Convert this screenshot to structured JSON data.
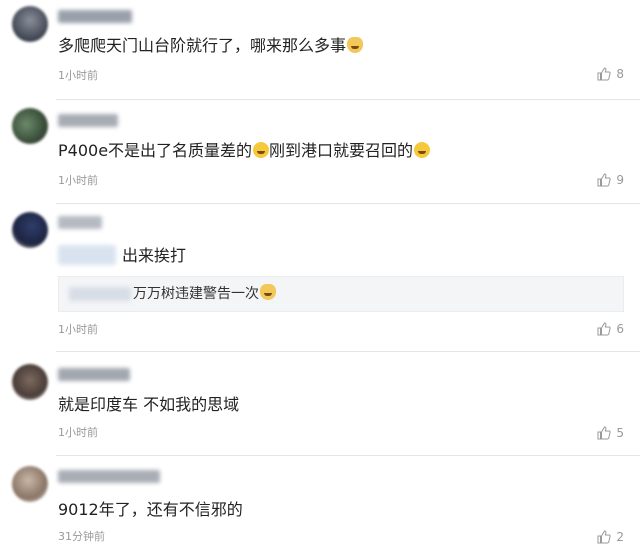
{
  "comments": [
    {
      "text": "多爬爬天门山台阶就行了，哪来那么多事",
      "emoji": "emoji-cat",
      "time": "1小时前",
      "likes": "8"
    },
    {
      "text_before": "P400e不是出了名质量差的",
      "text_mid": "刚到港口就要召回的",
      "emoji": "emoji-laugh-cry",
      "time": "1小时前",
      "likes": "9"
    },
    {
      "text": "出来挨打",
      "quote": {
        "text": "万万树违建警告一次",
        "emoji": "emoji-cat"
      },
      "time": "1小时前",
      "likes": "6"
    },
    {
      "text": "就是印度车 不如我的思域",
      "time": "1小时前",
      "likes": "5"
    },
    {
      "text": "9012年了，还有不信邪的",
      "time": "31分钟前",
      "likes": "2"
    }
  ],
  "icons": {
    "like": "thumbs-up-icon"
  },
  "colors": {
    "muted": "#999999",
    "divider": "#e6e6e6",
    "quote_bg": "#f4f5f7"
  }
}
